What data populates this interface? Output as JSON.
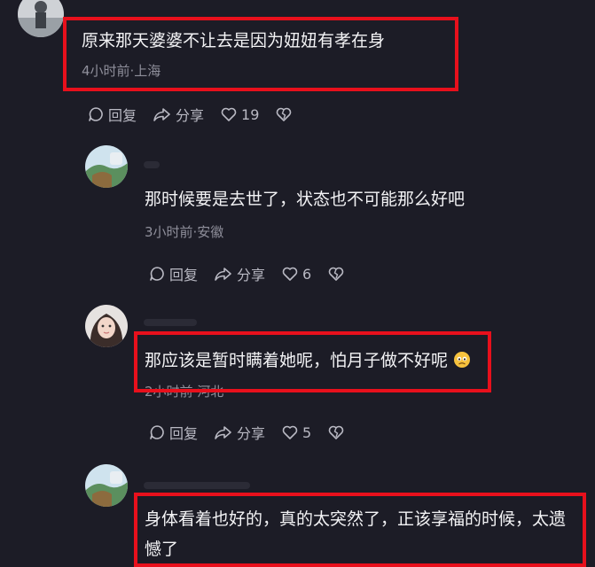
{
  "comments": [
    {
      "text": "原来那天婆婆不让去是因为妞妞有孝在身",
      "time_location": "4小时前·上海",
      "reply_label": "回复",
      "share_label": "分享",
      "like_count": "19"
    },
    {
      "text": "那时候要是去世了，状态也不可能那么好吧",
      "time_location": "3小时前·安徽",
      "reply_label": "回复",
      "share_label": "分享",
      "like_count": "6"
    },
    {
      "text": "那应该是暂时瞒着她呢，怕月子做不好呢",
      "time_location": "2小时前·河北",
      "reply_label": "回复",
      "share_label": "分享",
      "like_count": "5"
    },
    {
      "text": "身体看着也好的，真的太突然了，正该享福的时候，太遗憾了"
    }
  ],
  "colors": {
    "background": "#1c1c26",
    "highlight": "#e8101c",
    "text": "#f3f3f5",
    "meta": "#8f8f9b"
  },
  "icons": [
    "reply-icon",
    "share-icon",
    "heart-icon",
    "dislike-heart-icon",
    "worried-emoji-icon"
  ]
}
